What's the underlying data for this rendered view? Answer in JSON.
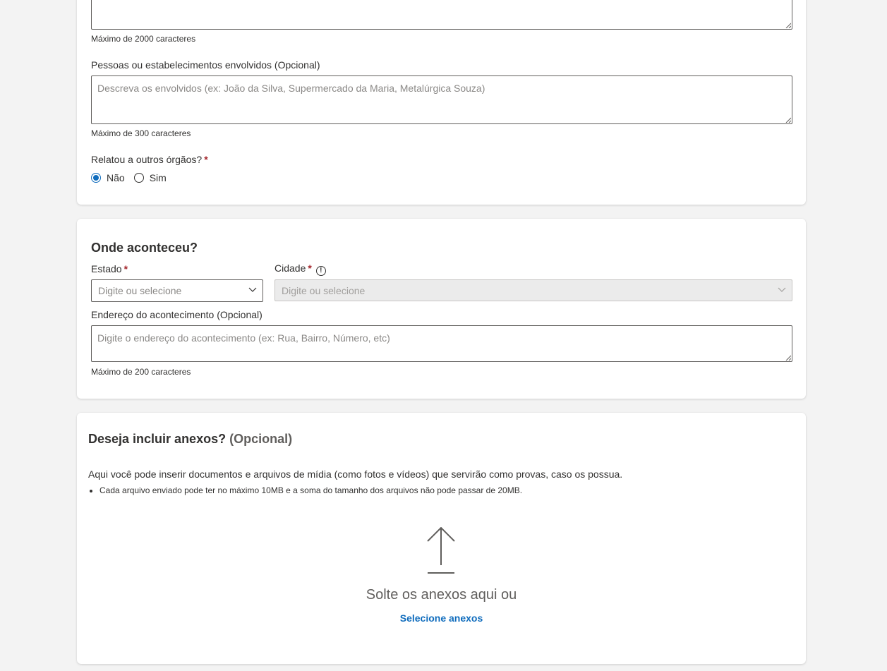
{
  "description_field": {
    "hint": "Máximo de 2000 caracteres"
  },
  "involved_field": {
    "label": "Pessoas ou estabelecimentos envolvidos (Opcional)",
    "placeholder": "Descreva os envolvidos (ex: João da Silva, Supermercado da Maria, Metalúrgica Souza)",
    "hint": "Máximo de 300 caracteres"
  },
  "reported_field": {
    "label": "Relatou a outros órgãos?",
    "required_mark": "*",
    "options": [
      {
        "label": "Não",
        "checked": true
      },
      {
        "label": "Sim",
        "checked": false
      }
    ]
  },
  "where_section": {
    "title": "Onde aconteceu?",
    "state": {
      "label": "Estado",
      "required_mark": "*",
      "placeholder": "Digite ou selecione"
    },
    "city": {
      "label": "Cidade",
      "required_mark": "*",
      "info_icon": "info-icon",
      "info_glyph": "!",
      "placeholder": "Digite ou selecione",
      "disabled": true
    },
    "address": {
      "label": "Endereço do acontecimento (Opcional)",
      "placeholder": "Digite o endereço do acontecimento (ex: Rua, Bairro, Número, etc)",
      "hint": "Máximo de 200 caracteres"
    }
  },
  "attachments_section": {
    "title": "Deseja incluir anexos?",
    "title_optional": "(Opcional)",
    "description": "Aqui você pode inserir documentos e arquivos de mídia (como fotos e vídeos) que servirão como provas, caso os possua.",
    "rules": [
      "Cada arquivo enviado pode ter no máximo 10MB e a soma do tamanho dos arquivos não pode passar de 20MB."
    ],
    "drop_icon": "upload-arrow-icon",
    "drop_text": "Solte os anexos aqui ou",
    "select_link": "Selecione anexos"
  },
  "colors": {
    "accent": "#0f6cbd",
    "required": "#a4262c",
    "background": "#f3f3f3"
  }
}
